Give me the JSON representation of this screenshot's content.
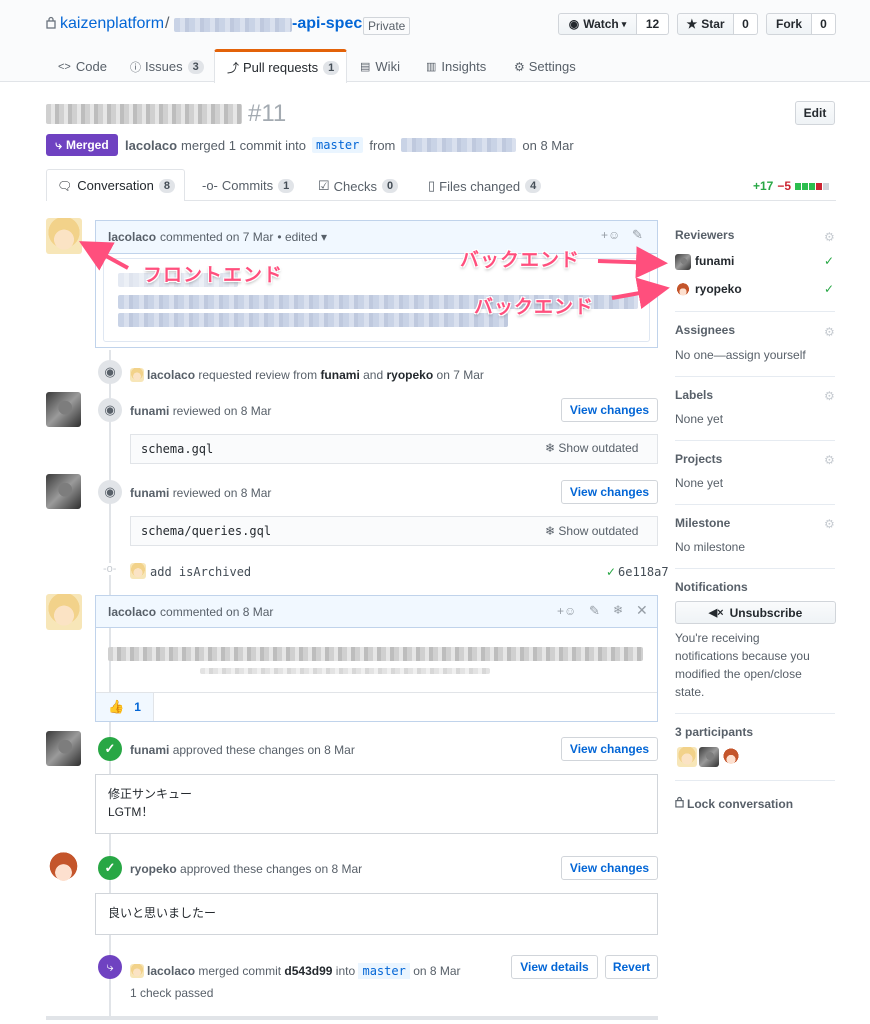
{
  "repo": {
    "owner": "kaizenplatform",
    "name_suffix": "-api-spec",
    "visibility": "Private"
  },
  "repo_actions": {
    "watch_label": "Watch",
    "watch_count": "12",
    "star_label": "Star",
    "star_count": "0",
    "fork_label": "Fork",
    "fork_count": "0"
  },
  "tabs": [
    {
      "label": "Code",
      "icon": "code-icon"
    },
    {
      "label": "Issues",
      "count": "3",
      "icon": "issue-icon"
    },
    {
      "label": "Pull requests",
      "count": "1",
      "icon": "pull-request-icon"
    },
    {
      "label": "Wiki",
      "icon": "book-icon"
    },
    {
      "label": "Insights",
      "icon": "graph-icon"
    },
    {
      "label": "Settings",
      "icon": "gear-icon"
    }
  ],
  "pr": {
    "number": "#11",
    "edit_label": "Edit",
    "state": "Merged",
    "author": "lacolaco",
    "merge_text": "merged 1 commit into",
    "base_branch": "master",
    "from_text": "from",
    "date_text": "on 8 Mar"
  },
  "pr_tabs": [
    {
      "label": "Conversation",
      "count": "8"
    },
    {
      "label": "Commits",
      "count": "1"
    },
    {
      "label": "Checks",
      "count": "0"
    },
    {
      "label": "Files changed",
      "count": "4"
    }
  ],
  "diffstat": {
    "additions": "+17",
    "deletions": "−5"
  },
  "timeline": {
    "first_comment": {
      "author": "lacolaco",
      "meta": "commented on 7 Mar",
      "edited": "• edited ▾"
    },
    "review_request": {
      "author": "lacolaco",
      "text1": "requested review from",
      "user1": "funami",
      "and": "and",
      "user2": "ryopeko",
      "date": "on 7 Mar"
    },
    "review1": {
      "author": "funami",
      "meta": "reviewed on 8 Mar",
      "view_label": "View changes",
      "file": "schema.gql",
      "outdated": "Show outdated"
    },
    "review2": {
      "author": "funami",
      "meta": "reviewed on 8 Mar",
      "view_label": "View changes",
      "file": "schema/queries.gql",
      "outdated": "Show outdated"
    },
    "commit": {
      "message": "add isArchived",
      "sha": "6e118a7"
    },
    "second_comment": {
      "author": "lacolaco",
      "meta": "commented on 8 Mar",
      "reaction_count": "1"
    },
    "approve1": {
      "author": "funami",
      "meta": "approved these changes on 8 Mar",
      "view_label": "View changes",
      "line1": "修正サンキュー",
      "line2": "LGTM！"
    },
    "approve2": {
      "author": "ryopeko",
      "meta": "approved these changes on 8 Mar",
      "view_label": "View changes",
      "line1": "良いと思いましたー"
    },
    "merge": {
      "author": "lacolaco",
      "text": "merged commit",
      "sha": "d543d99",
      "into": "into",
      "branch": "master",
      "date": "on 8 Mar",
      "details_label": "View details",
      "revert_label": "Revert",
      "checks": "1 check passed"
    }
  },
  "sidebar": {
    "reviewers_title": "Reviewers",
    "reviewers": [
      "funami",
      "ryopeko"
    ],
    "assignees_title": "Assignees",
    "assignees_value": "No one—assign yourself",
    "labels_title": "Labels",
    "labels_value": "None yet",
    "projects_title": "Projects",
    "projects_value": "None yet",
    "milestone_title": "Milestone",
    "milestone_value": "No milestone",
    "notifications_title": "Notifications",
    "unsubscribe_label": "Unsubscribe",
    "notifications_text": [
      "You're receiving",
      "notifications because you",
      "modified the open/close",
      "state."
    ],
    "participants_title": "3 participants",
    "lock_label": "Lock conversation"
  },
  "annotations": {
    "frontend": "フロントエンド",
    "backend1": "バックエンド",
    "backend2": "バックエンド"
  },
  "colors": {
    "link": "#0366d6",
    "merged": "#6f42c1",
    "success": "#28a745",
    "annotation": "#ff4f7d"
  }
}
